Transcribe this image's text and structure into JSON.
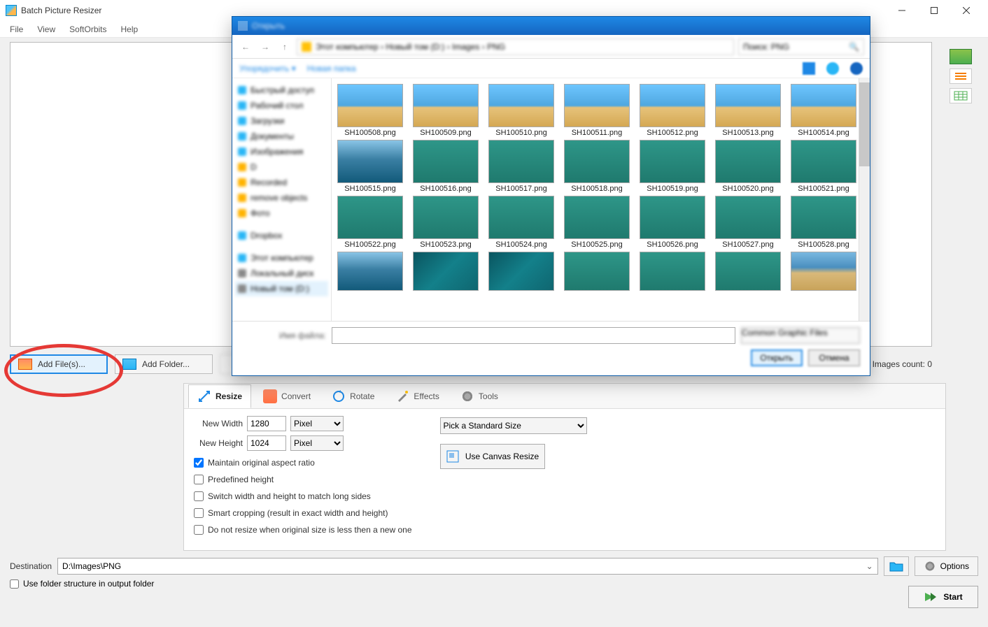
{
  "app": {
    "title": "Batch Picture Resizer"
  },
  "menu": {
    "file": "File",
    "view": "View",
    "softorbits": "SoftOrbits",
    "help": "Help"
  },
  "toolbar": {
    "add_files": "Add File(s)...",
    "add_folder": "Add Folder...",
    "images_count_label": "Images count:",
    "images_count_value": "0"
  },
  "tabs": {
    "resize": "Resize",
    "convert": "Convert",
    "rotate": "Rotate",
    "effects": "Effects",
    "tools": "Tools"
  },
  "resize_panel": {
    "new_width_label": "New Width",
    "new_width_value": "1280",
    "new_height_label": "New Height",
    "new_height_value": "1024",
    "unit": "Pixel",
    "maintain_aspect": "Maintain original aspect ratio",
    "predefined_height": "Predefined height",
    "switch_wh": "Switch width and height to match long sides",
    "smart_crop": "Smart cropping (result in exact width and height)",
    "no_resize_smaller": "Do not resize when original size is less then a new one",
    "std_size": "Pick a Standard Size",
    "canvas_resize": "Use Canvas Resize"
  },
  "bottom": {
    "destination_label": "Destination",
    "destination_value": "D:\\Images\\PNG",
    "options": "Options",
    "use_folder_structure": "Use folder structure in output folder",
    "start": "Start"
  },
  "file_dialog": {
    "files": [
      [
        "SH100508.png",
        "SH100509.png",
        "SH100510.png",
        "SH100511.png",
        "SH100512.png",
        "SH100513.png",
        "SH100514.png"
      ],
      [
        "SH100515.png",
        "SH100516.png",
        "SH100517.png",
        "SH100518.png",
        "SH100519.png",
        "SH100520.png",
        "SH100521.png"
      ],
      [
        "SH100522.png",
        "SH100523.png",
        "SH100524.png",
        "SH100525.png",
        "SH100526.png",
        "SH100527.png",
        "SH100528.png"
      ]
    ],
    "themes": [
      [
        "beach",
        "beach",
        "beach",
        "beach",
        "beach",
        "beach",
        "beach"
      ],
      [
        "pier",
        "sea",
        "sea",
        "sea",
        "sea",
        "sea",
        "sea"
      ],
      [
        "sea",
        "sea",
        "sea",
        "sea",
        "sea",
        "sea",
        "sea"
      ]
    ],
    "partial_themes": [
      "pier",
      "diver",
      "diver",
      "sea",
      "sea",
      "sea",
      "shore"
    ]
  }
}
